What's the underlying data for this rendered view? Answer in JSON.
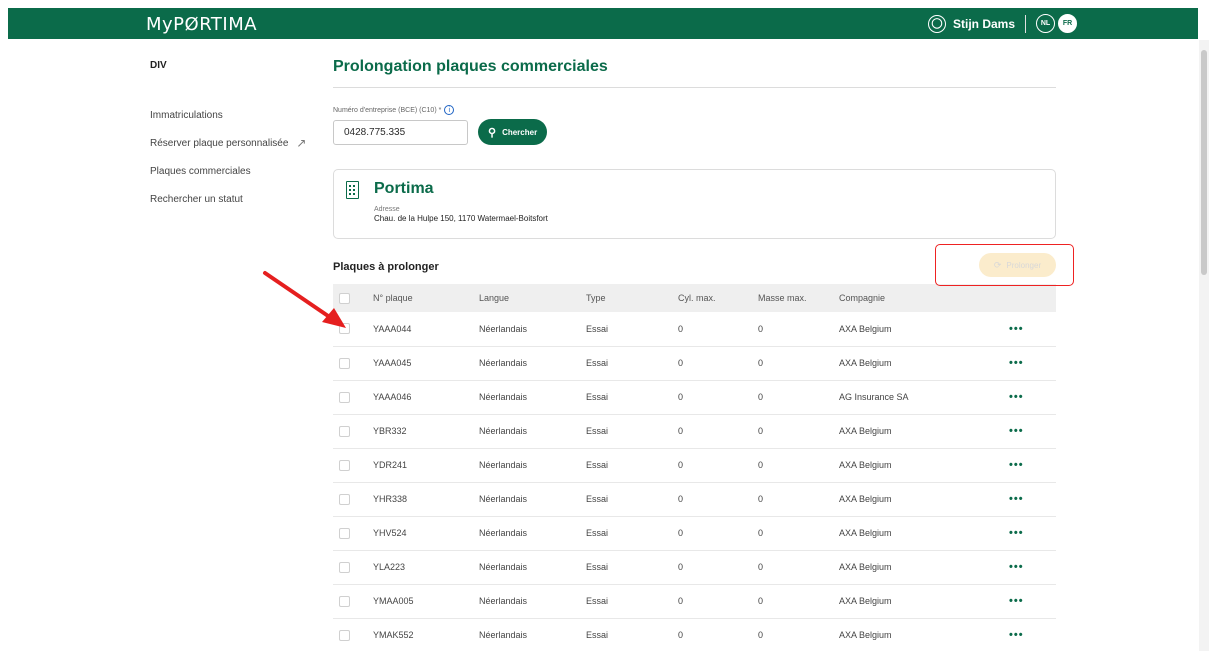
{
  "header": {
    "logo": "MyPØRTIMA",
    "user_name": "Stijn Dams",
    "lang_nl": "NL",
    "lang_fr": "FR",
    "brand_color": "#0b6b4a"
  },
  "sidebar": {
    "title": "DIV",
    "items": [
      {
        "label": "Immatriculations"
      },
      {
        "label": "Réserver plaque personnalisée"
      },
      {
        "label": "Plaques commerciales"
      },
      {
        "label": "Rechercher un statut"
      }
    ]
  },
  "main": {
    "title": "Prolongation plaques commerciales",
    "field_label": "Numéro d'entreprise (BCE) (C10) *",
    "field_value": "0428.775.335",
    "search_button": "Chercher",
    "company": {
      "name": "Portima",
      "address_label": "Adresse",
      "address": "Chau. de la Hulpe 150, 1170 Watermael-Boitsfort"
    },
    "section_title": "Plaques à prolonger",
    "prolonger_button": "Prolonger"
  },
  "table": {
    "headers": [
      "N° plaque",
      "Langue",
      "Type",
      "Cyl. max.",
      "Masse max.",
      "Compagnie"
    ],
    "rows": [
      {
        "plate": "YAAA044",
        "lang": "Néerlandais",
        "type": "Essai",
        "cyl": "0",
        "mass": "0",
        "company": "AXA Belgium"
      },
      {
        "plate": "YAAA045",
        "lang": "Néerlandais",
        "type": "Essai",
        "cyl": "0",
        "mass": "0",
        "company": "AXA Belgium"
      },
      {
        "plate": "YAAA046",
        "lang": "Néerlandais",
        "type": "Essai",
        "cyl": "0",
        "mass": "0",
        "company": "AG Insurance SA"
      },
      {
        "plate": "YBR332",
        "lang": "Néerlandais",
        "type": "Essai",
        "cyl": "0",
        "mass": "0",
        "company": "AXA Belgium"
      },
      {
        "plate": "YDR241",
        "lang": "Néerlandais",
        "type": "Essai",
        "cyl": "0",
        "mass": "0",
        "company": "AXA Belgium"
      },
      {
        "plate": "YHR338",
        "lang": "Néerlandais",
        "type": "Essai",
        "cyl": "0",
        "mass": "0",
        "company": "AXA Belgium"
      },
      {
        "plate": "YHV524",
        "lang": "Néerlandais",
        "type": "Essai",
        "cyl": "0",
        "mass": "0",
        "company": "AXA Belgium"
      },
      {
        "plate": "YLA223",
        "lang": "Néerlandais",
        "type": "Essai",
        "cyl": "0",
        "mass": "0",
        "company": "AXA Belgium"
      },
      {
        "plate": "YMAA005",
        "lang": "Néerlandais",
        "type": "Essai",
        "cyl": "0",
        "mass": "0",
        "company": "AXA Belgium"
      },
      {
        "plate": "YMAK552",
        "lang": "Néerlandais",
        "type": "Essai",
        "cyl": "0",
        "mass": "0",
        "company": "AXA Belgium"
      }
    ]
  }
}
